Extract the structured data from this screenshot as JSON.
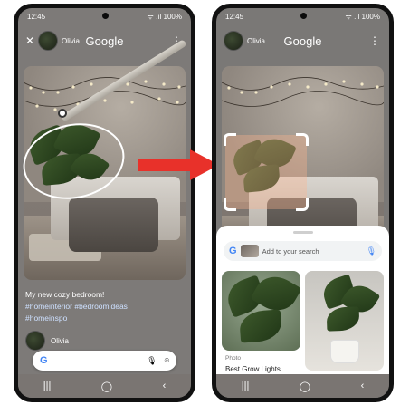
{
  "status": {
    "time": "12:45",
    "battery": "100%",
    "signal": "ᯤ .ıl"
  },
  "header": {
    "close": "✕",
    "username": "Olivia",
    "title": "Google",
    "menu": "⋮"
  },
  "post": {
    "caption": "My new cozy bedroom!",
    "hashtags_line1": "#homeinterior #bedroomideas",
    "hashtags_line2": "#homeinspo"
  },
  "author": {
    "name": "Olivia"
  },
  "search_bar": {
    "logo": "G",
    "mic": "🎙",
    "lens": "⌾"
  },
  "sheet": {
    "search_placeholder": "Add to your search",
    "mic": "🎙",
    "logo": "G"
  },
  "results": [
    {
      "source": "Photo",
      "title": "Best Grow Lights"
    }
  ],
  "nav": {
    "recents": "|||",
    "home": "◯",
    "back": "‹"
  },
  "colors": {
    "accent_arrow": "#e8312a",
    "google_blue": "#4285f4"
  }
}
